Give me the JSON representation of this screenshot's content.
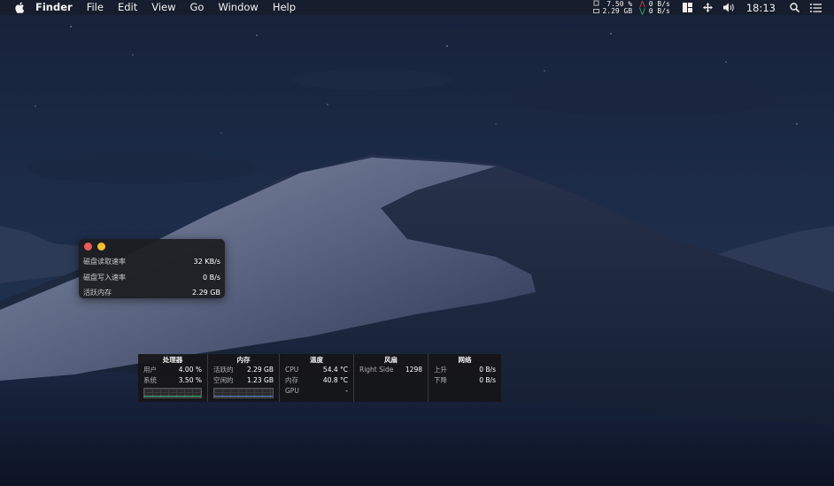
{
  "menubar": {
    "app_name": "Finder",
    "menus": [
      "File",
      "Edit",
      "View",
      "Go",
      "Window",
      "Help"
    ],
    "cpu_percent": "7.50 %",
    "mem_used": "2.29 GB",
    "net_up": "0 B/s",
    "net_down": "0 B/s",
    "clock": "18:13"
  },
  "disk_window": {
    "rows": [
      {
        "label": "磁盘读取速率",
        "value": "32 KB/s"
      },
      {
        "label": "磁盘写入速率",
        "value": "0 B/s"
      },
      {
        "label": "活跃内存",
        "value": "2.29 GB"
      }
    ]
  },
  "stats_panel": {
    "cpu": {
      "title": "处理器",
      "rows": [
        {
          "k": "用户",
          "v": "4.00 %"
        },
        {
          "k": "系统",
          "v": "3.50 %"
        }
      ]
    },
    "memory": {
      "title": "内存",
      "rows": [
        {
          "k": "活跃的",
          "v": "2.29 GB"
        },
        {
          "k": "空闲的",
          "v": "1.23 GB"
        }
      ]
    },
    "temperature": {
      "title": "温度",
      "rows": [
        {
          "k": "CPU",
          "v": "54.4 °C"
        },
        {
          "k": "内存",
          "v": "40.8 °C"
        },
        {
          "k": "GPU",
          "v": "-"
        }
      ]
    },
    "fan": {
      "title": "风扇",
      "rows": [
        {
          "k": "Right Side",
          "v": "1298"
        }
      ]
    },
    "network": {
      "title": "网络",
      "rows": [
        {
          "k": "上升",
          "v": "0 B/s"
        },
        {
          "k": "下降",
          "v": "0 B/s"
        }
      ]
    }
  },
  "colors": {
    "close": "#ee5c56",
    "minimize": "#f4be2e",
    "net_up_arrow": "#e0505a",
    "net_down_arrow": "#3fc27a"
  },
  "icons": [
    "apple-icon",
    "cpu-chip-icon",
    "memory-icon",
    "layout-icon",
    "move-icon",
    "volume-icon",
    "search-icon",
    "list-icon"
  ]
}
